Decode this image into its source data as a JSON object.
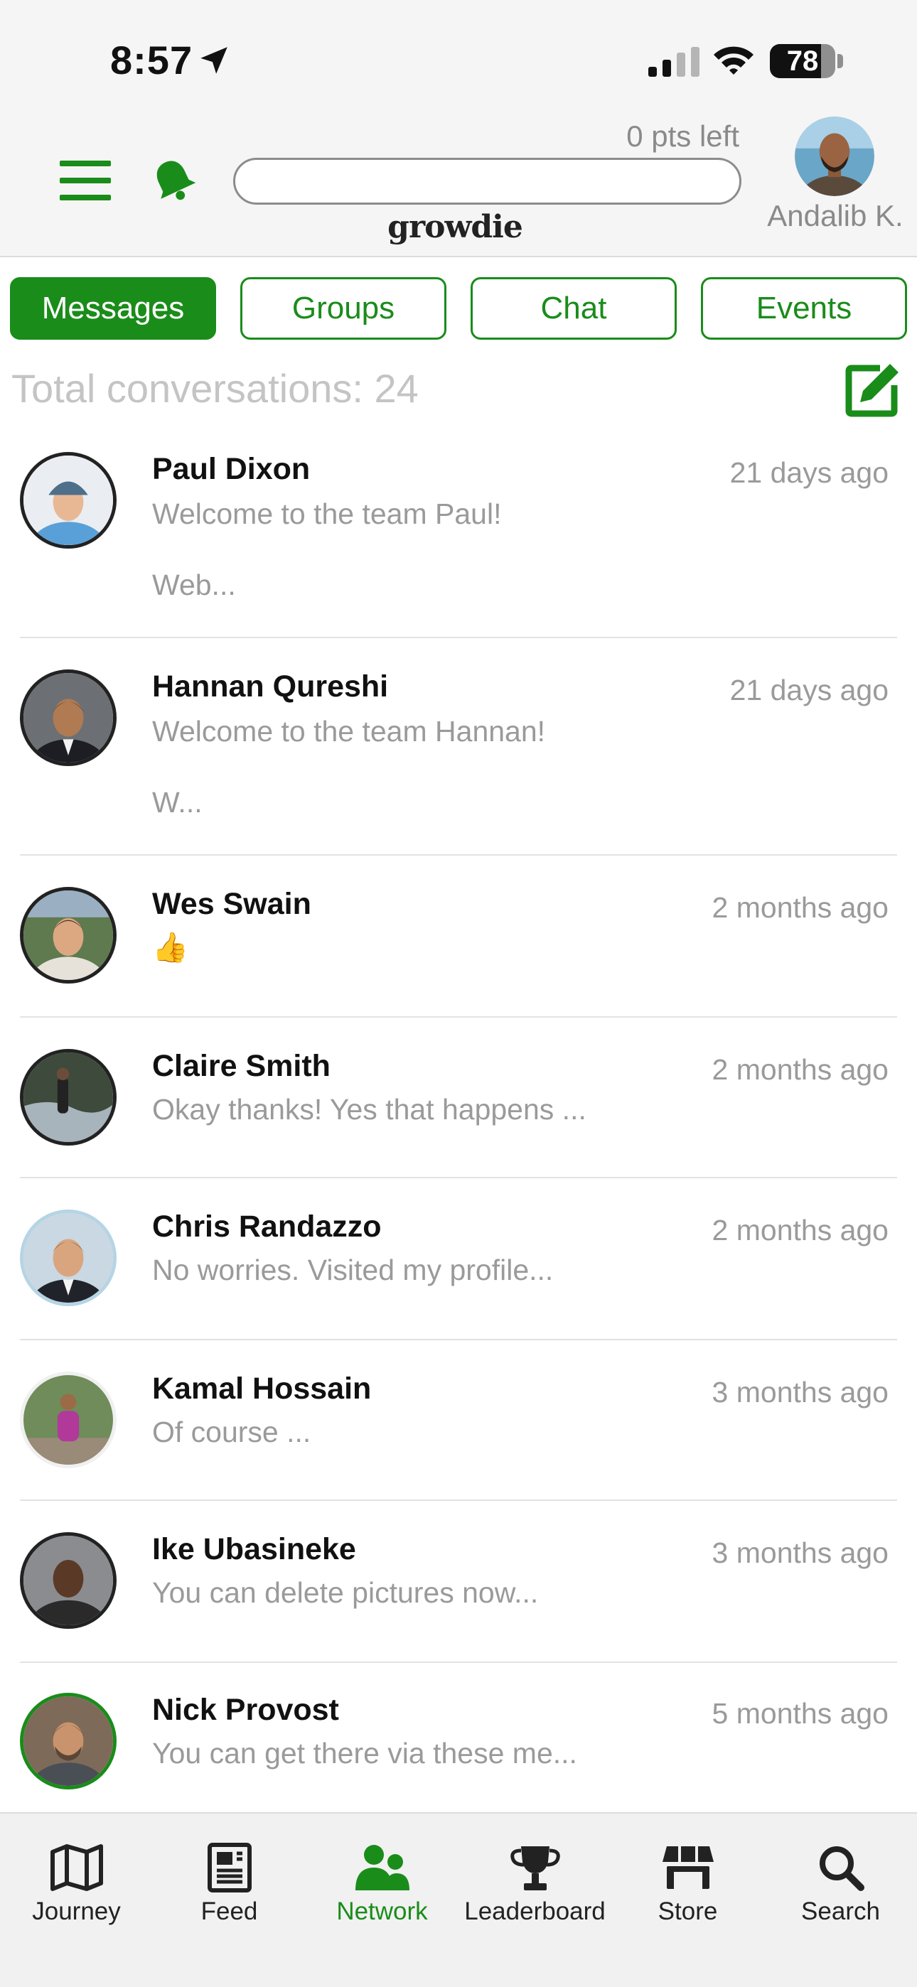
{
  "status_bar": {
    "time": "8:57",
    "battery": "78",
    "battery_level": 0.78
  },
  "header": {
    "points_text": "0 pts left",
    "progress": 0,
    "brand": "growdie",
    "user_name": "Andalib K."
  },
  "tabs": [
    {
      "label": "Messages",
      "active": true
    },
    {
      "label": "Groups",
      "active": false
    },
    {
      "label": "Chat",
      "active": false
    },
    {
      "label": "Events",
      "active": false
    }
  ],
  "total_conversations": "Total conversations: 24",
  "conversations": [
    {
      "name": "Paul Dixon",
      "time": "21 days ago",
      "message": "Welcome to the team Paul!",
      "extra": "Web..."
    },
    {
      "name": "Hannan Qureshi",
      "time": "21 days ago",
      "message": "Welcome to the team Hannan!",
      "extra": "W..."
    },
    {
      "name": "Wes Swain",
      "time": "2 months ago",
      "message": "👍",
      "extra": ""
    },
    {
      "name": "Claire Smith",
      "time": "2 months ago",
      "message": "Okay thanks! Yes that happens ...",
      "extra": ""
    },
    {
      "name": "Chris Randazzo",
      "time": "2 months ago",
      "message": "No worries. Visited my profile...",
      "extra": ""
    },
    {
      "name": "Kamal Hossain",
      "time": "3 months ago",
      "message": "Of course ...",
      "extra": ""
    },
    {
      "name": "Ike Ubasineke",
      "time": "3 months ago",
      "message": "You can delete pictures now...",
      "extra": ""
    },
    {
      "name": "Nick Provost",
      "time": "5 months ago",
      "message": "You can get there via these me...",
      "extra": ""
    }
  ],
  "nav": [
    {
      "label": "Journey",
      "icon": "map-icon",
      "active": false
    },
    {
      "label": "Feed",
      "icon": "newspaper-icon",
      "active": false
    },
    {
      "label": "Network",
      "icon": "people-icon",
      "active": true
    },
    {
      "label": "Leaderboard",
      "icon": "trophy-icon",
      "active": false
    },
    {
      "label": "Store",
      "icon": "store-icon",
      "active": false
    },
    {
      "label": "Search",
      "icon": "search-icon",
      "active": false
    }
  ],
  "colors": {
    "accent": "#1a8c1a",
    "muted_text": "#9a9a9a"
  }
}
